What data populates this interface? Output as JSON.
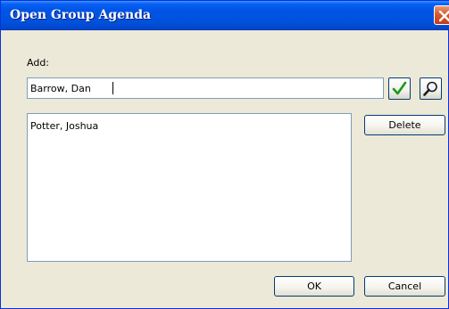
{
  "window": {
    "title": "Open Group Agenda"
  },
  "add": {
    "label": "Add:",
    "input_value": "Barrow, Dan"
  },
  "icons": {
    "confirm": "checkmark-icon",
    "lookup": "magnifier-icon",
    "close": "close-icon"
  },
  "attendees": {
    "items": [
      "Potter, Joshua"
    ]
  },
  "buttons": {
    "delete": "Delete",
    "ok": "OK",
    "cancel": "Cancel"
  },
  "colors": {
    "titlebar": "#0055e5",
    "dialog_bg": "#ece9d8",
    "close_button": "#d7592c",
    "checkmark": "#1a9a1a"
  }
}
